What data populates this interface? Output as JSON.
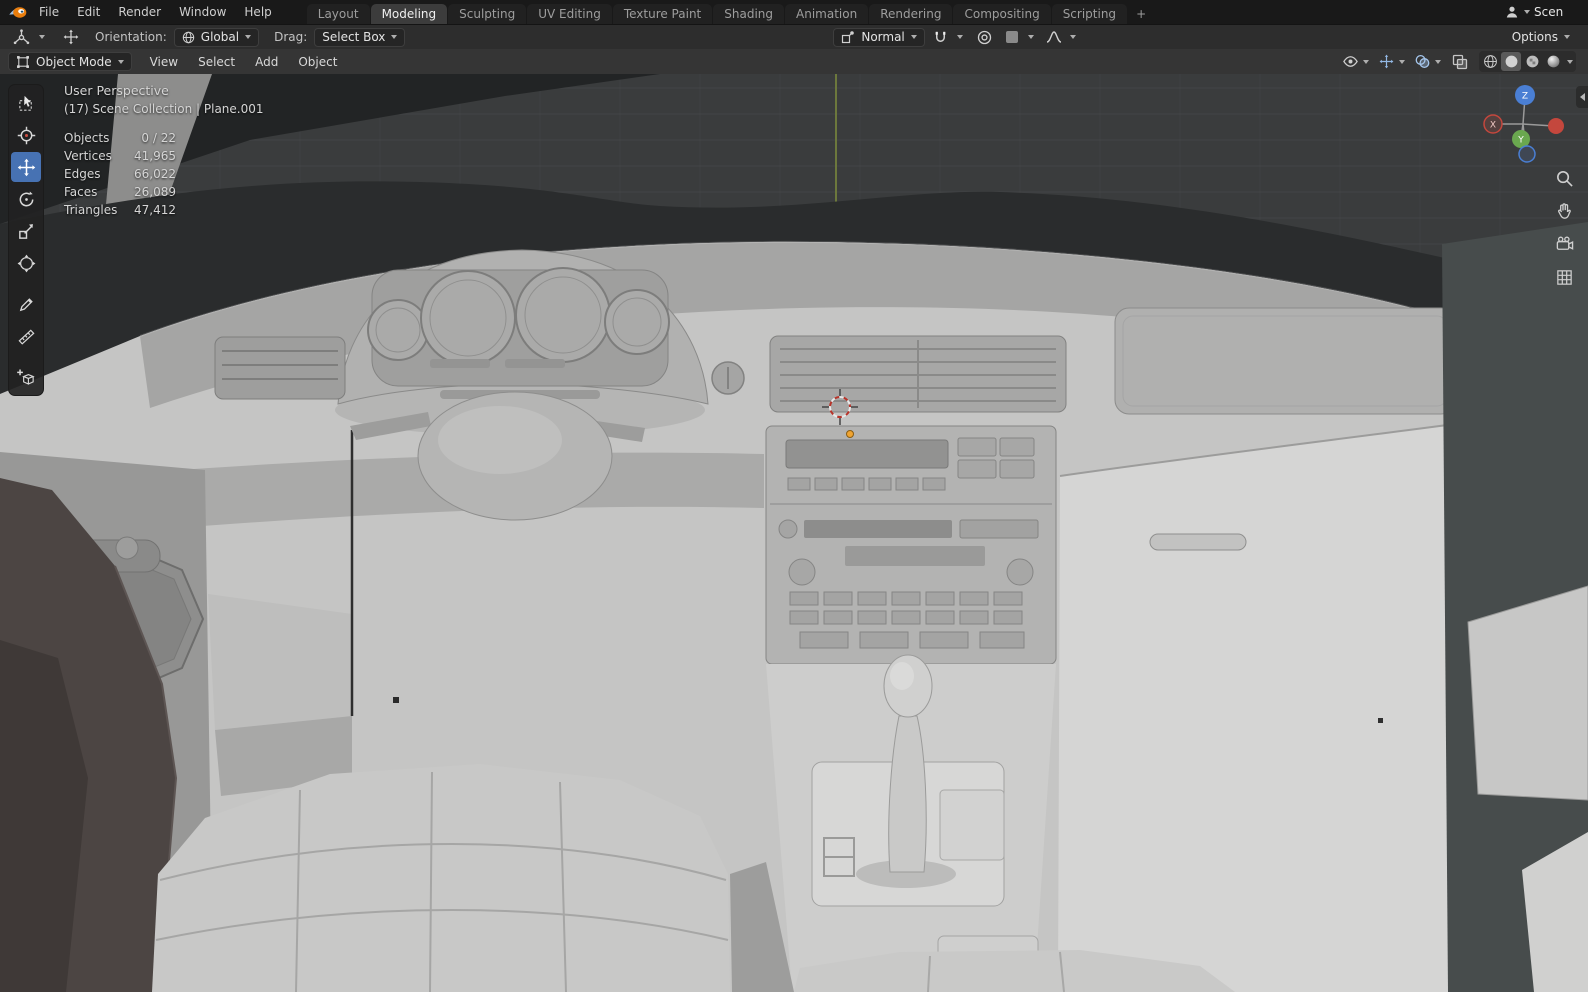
{
  "topbar": {
    "menus": [
      "File",
      "Edit",
      "Render",
      "Window",
      "Help"
    ],
    "workspaces": [
      "Layout",
      "Modeling",
      "Sculpting",
      "UV Editing",
      "Texture Paint",
      "Shading",
      "Animation",
      "Rendering",
      "Compositing",
      "Scripting"
    ],
    "active_workspace": "Modeling",
    "add_workspace": "+",
    "scene_label": "Scen"
  },
  "tool_settings": {
    "orientation_label": "Orientation:",
    "orientation_value": "Global",
    "drag_label": "Drag:",
    "drag_value": "Select Box",
    "snap_with_value": "Normal",
    "options_label": "Options"
  },
  "viewport_header": {
    "mode": "Object Mode",
    "menus": [
      "View",
      "Select",
      "Add",
      "Object"
    ]
  },
  "viewport_overlay": {
    "view_name": "User Perspective",
    "context_path": "(17) Scene Collection | Plane.001",
    "stats": [
      {
        "label": "Objects",
        "value": "0 / 22"
      },
      {
        "label": "Vertices",
        "value": "41,965"
      },
      {
        "label": "Edges",
        "value": "66,022"
      },
      {
        "label": "Faces",
        "value": "26,089"
      },
      {
        "label": "Triangles",
        "value": "47,412"
      }
    ]
  },
  "nav_gizmo": {
    "axis_x": "X",
    "axis_y": "Y",
    "axis_z": "Z"
  },
  "colors": {
    "accent": "#4772b3",
    "axis_x": "#c4473d",
    "axis_y": "#6aa84f",
    "axis_z": "#4a7fd4",
    "origin_dot": "#f0a431",
    "topbar_bg": "#191919",
    "header_bg": "#353535",
    "viewport_bg": "#3a3c3d",
    "model_gray": "#c5c5c4"
  },
  "icons": {
    "blender-logo-icon": "blender mark",
    "dropdown-caret-icon": "small down triangle",
    "user-icon": "person silhouette",
    "active-tool-icon": "axis gizmo",
    "move-gizmo-icon": "four arrows",
    "globe-icon": "globe",
    "snap-to-icon": "snap target",
    "magnet-icon": "magnet",
    "proportional-editing-icon": "concentric circles",
    "falloff-swatch-icon": "square swatch",
    "falloff-curve-icon": "smooth curve",
    "object-mode-icon": "square with corner verts",
    "visibility-icon": "eye",
    "gizmos-toggle-icon": "move arrows",
    "overlays-icon": "two overlapping circles",
    "xray-icon": "overlapping squares",
    "shading-wireframe-icon": "wire sphere",
    "shading-solid-icon": "solid sphere",
    "shading-material-icon": "checker sphere",
    "shading-rendered-icon": "shaded sphere",
    "select-box-tool-icon": "cursor with dashed box",
    "cursor-tool-icon": "crosshair circle",
    "move-tool-icon": "four arrows",
    "rotate-tool-icon": "circular arrow",
    "scale-tool-icon": "square with diagonal arrow",
    "transform-tool-icon": "circle with arrows",
    "annotate-tool-icon": "pencil",
    "measure-tool-icon": "ruler",
    "add-cube-tool-icon": "cube with plus",
    "zoom-icon": "magnifier",
    "pan-icon": "hand",
    "camera-view-icon": "camera",
    "ortho-grid-icon": "grid",
    "sidebar-toggle-icon": "chevron-left"
  }
}
